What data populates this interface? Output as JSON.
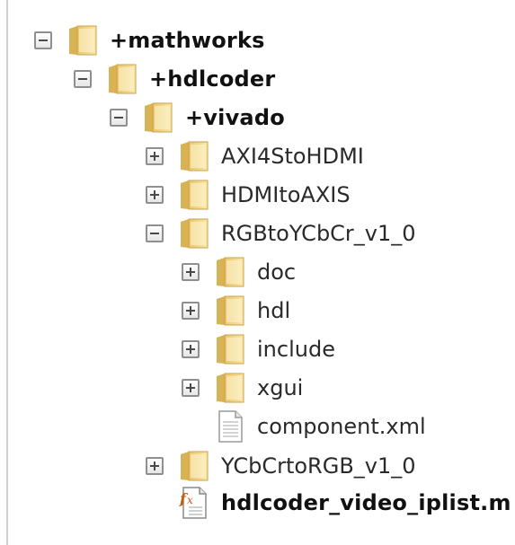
{
  "tree": {
    "mathworks": "+mathworks",
    "hdlcoder": "+hdlcoder",
    "vivado": "+vivado",
    "axi4stohdmi": "AXI4StoHDMI",
    "hdmitoaxis": "HDMItoAXIS",
    "rgbtoycbcr": "RGBtoYCbCr_v1_0",
    "doc": "doc",
    "hdl": "hdl",
    "include": "include",
    "xgui": "xgui",
    "component": "component.xml",
    "ycbcrtorgb": "YCbCrtoRGB_v1_0",
    "iplist": "hdlcoder_video_iplist.m"
  },
  "icons": {
    "folder": "folder-icon",
    "xml_file": "xml-file-icon",
    "matlab_function_file": "fx-file-icon",
    "expand": "plus-box",
    "collapse": "minus-box"
  },
  "colors": {
    "folder_light": "#fbe9b0",
    "folder_dark": "#e2be63",
    "text_bold": "#111111",
    "text_normal": "#2a2a2a"
  }
}
